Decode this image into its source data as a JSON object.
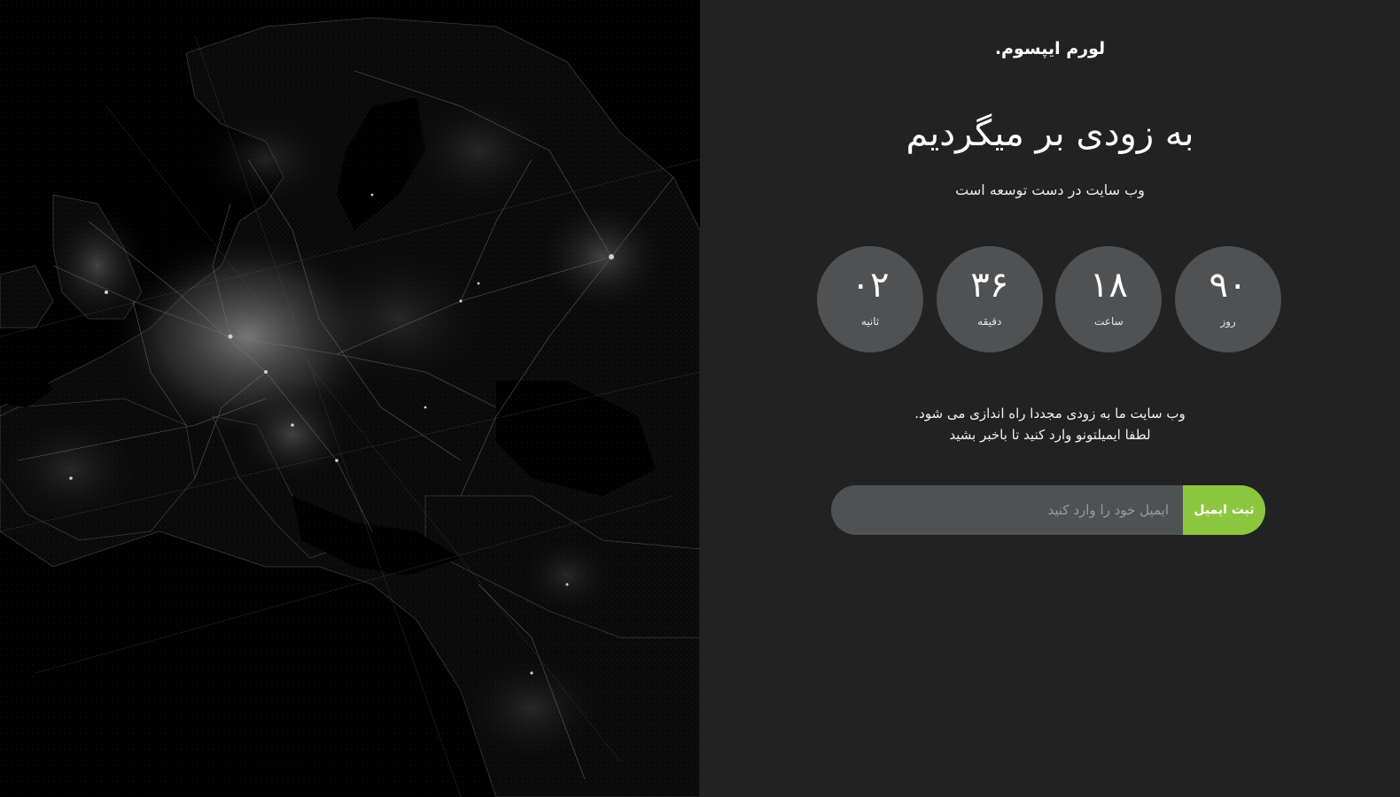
{
  "brand": "لورم ایپسوم.",
  "headline": "به زودی بر میگردیم",
  "subheadline": "وب سایت در دست توسعه است",
  "countdown": [
    {
      "value": "۹۰",
      "label": "روز"
    },
    {
      "value": "۱۸",
      "label": "ساعت"
    },
    {
      "value": "۳۶",
      "label": "دقیقه"
    },
    {
      "value": "۰۲",
      "label": "ثانیه"
    }
  ],
  "message": {
    "line1": "وب سایت ما به زودی مجددا راه اندازی می شود.",
    "line2": "لطفا ایمیلتونو وارد کنید تا باخبر بشید"
  },
  "subscribe": {
    "placeholder": "ایمیل خود را وارد کنید",
    "value": "",
    "button_label": "ثبت ایمیل"
  },
  "colors": {
    "accent": "#8cc63f",
    "panel_bg": "#222222",
    "circle_bg": "#505152",
    "map_bg": "#000000"
  },
  "map": {
    "image": "night-lights-europe-map"
  }
}
